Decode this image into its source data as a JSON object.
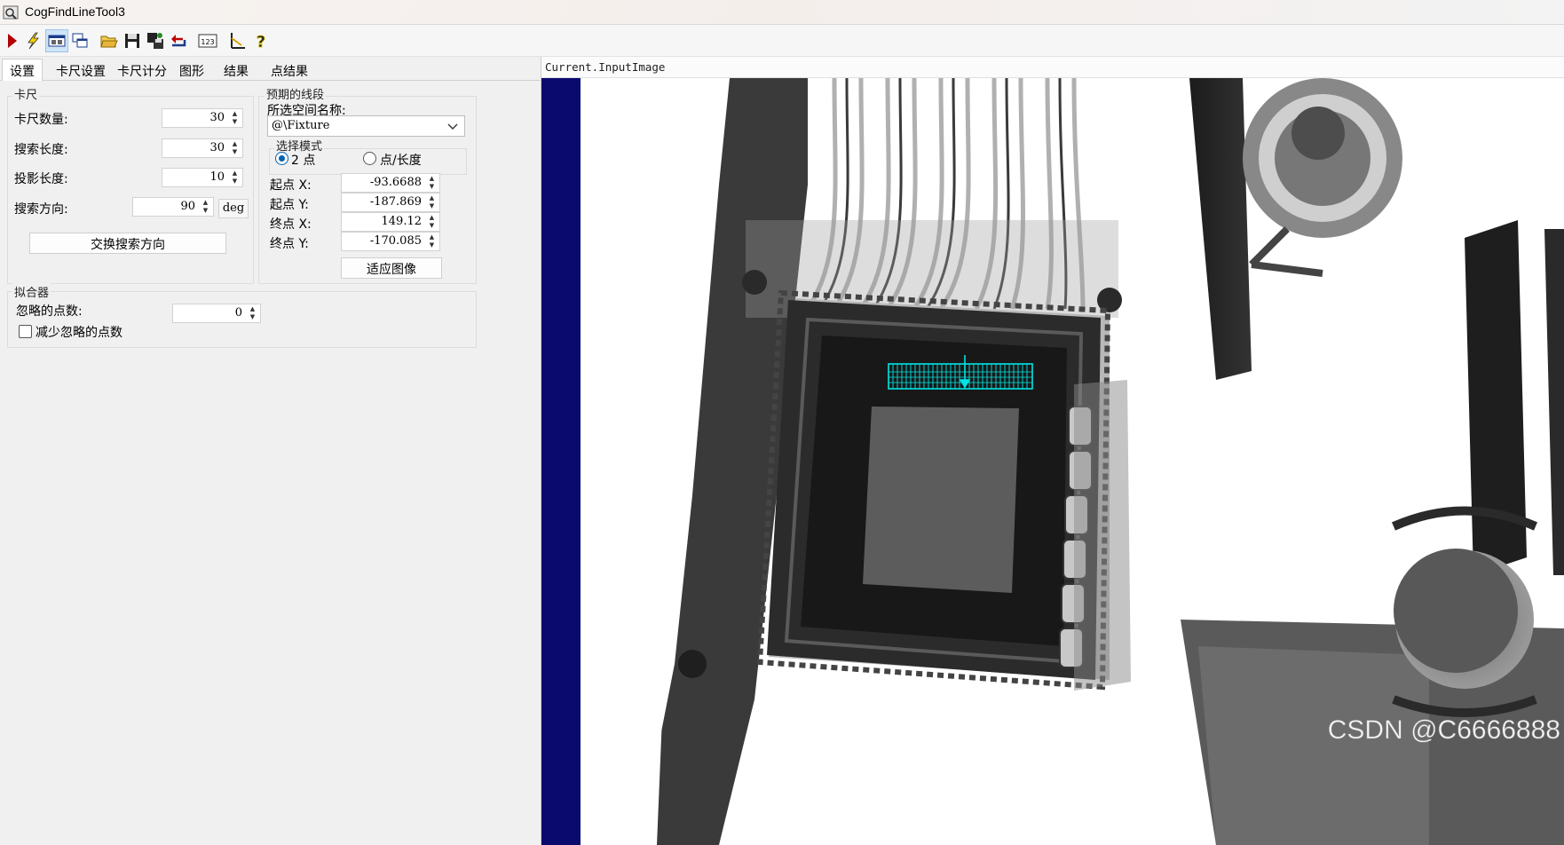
{
  "window": {
    "title": "CogFindLineTool3"
  },
  "toolbar": {
    "buttons": [
      {
        "name": "run",
        "icon": "run-icon"
      },
      {
        "name": "electric",
        "icon": "lightning-icon"
      },
      {
        "name": "show-image",
        "icon": "image-window-icon"
      },
      {
        "name": "float-window",
        "icon": "float-window-icon"
      },
      {
        "name": "open",
        "icon": "open-folder-icon"
      },
      {
        "name": "save",
        "icon": "save-icon"
      },
      {
        "name": "save-as",
        "icon": "save-as-icon"
      },
      {
        "name": "reset",
        "icon": "reset-icon"
      },
      {
        "name": "numeric",
        "icon": "numeric-123-icon"
      },
      {
        "name": "tool-settings",
        "icon": "ruler-icon"
      },
      {
        "name": "help",
        "icon": "help-icon"
      }
    ]
  },
  "tabs": [
    {
      "label": "设置",
      "active": true
    },
    {
      "label": "卡尺设置"
    },
    {
      "label": "卡尺计分"
    },
    {
      "label": "图形"
    },
    {
      "label": "结果"
    },
    {
      "label": "点结果"
    }
  ],
  "caliper": {
    "group_title": "卡尺",
    "count_label": "卡尺数量:",
    "count_value": "30",
    "search_length_label": "搜索长度:",
    "search_length_value": "30",
    "projection_length_label": "投影长度:",
    "projection_length_value": "10",
    "search_direction_label": "搜索方向:",
    "search_direction_value": "90",
    "search_direction_unit": "deg",
    "swap_button": "交换搜索方向"
  },
  "expected_segment": {
    "group_title": "预期的线段",
    "space_label": "所选空间名称:",
    "space_value": "@\\Fixture",
    "mode_title": "选择模式",
    "mode_two_point": "2 点",
    "mode_point_length": "点/长度",
    "start_x_label": "起点 X:",
    "start_x_value": "-93.6688",
    "start_y_label": "起点 Y:",
    "start_y_value": "-187.869",
    "end_x_label": "终点 X:",
    "end_x_value": "149.12",
    "end_y_label": "终点 Y:",
    "end_y_value": "-170.085",
    "fit_button": "适应图像"
  },
  "fitter": {
    "group_title": "拟合器",
    "ignore_label": "忽略的点数:",
    "ignore_value": "0",
    "reduce_label": "减少忽略的点数",
    "reduce_checked": false
  },
  "display": {
    "image_name": "Current.InputImage",
    "watermark": "CSDN @C6666888",
    "overlay_color": "#00e5e5"
  }
}
